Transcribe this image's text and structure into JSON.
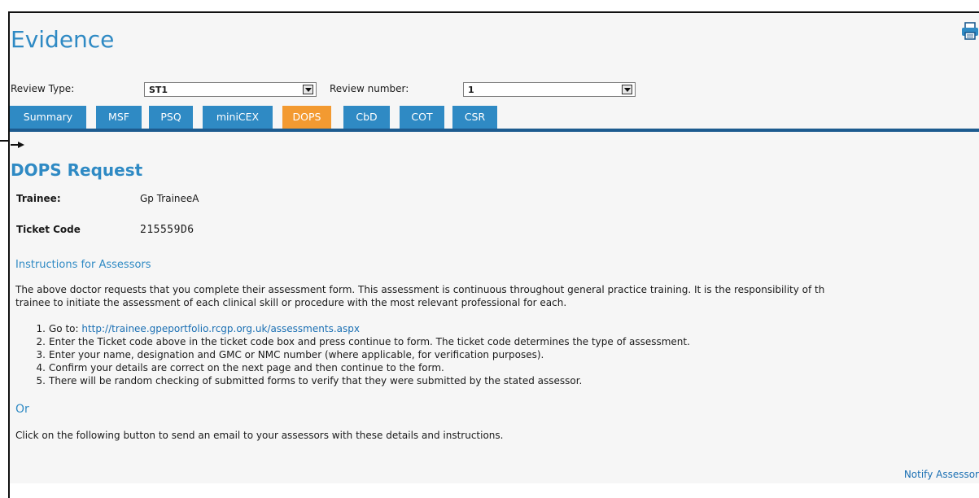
{
  "header": {
    "title": "Evidence"
  },
  "filters": {
    "review_type_label": "Review Type:",
    "review_type_value": "ST1",
    "review_number_label": "Review number:",
    "review_number_value": "1"
  },
  "tabs": [
    {
      "label": "Summary",
      "active": false
    },
    {
      "label": "MSF",
      "active": false
    },
    {
      "label": "PSQ",
      "active": false
    },
    {
      "label": "miniCEX",
      "active": false
    },
    {
      "label": "DOPS",
      "active": true
    },
    {
      "label": "CbD",
      "active": false
    },
    {
      "label": "COT",
      "active": false
    },
    {
      "label": "CSR",
      "active": false
    }
  ],
  "request": {
    "title": "DOPS Request",
    "trainee_label": "Trainee:",
    "trainee_value": "Gp TraineeA",
    "ticket_label": "Ticket Code",
    "ticket_value": "215559D6"
  },
  "instructions": {
    "heading": "Instructions for Assessors",
    "line1": "The above doctor requests that you complete their assessment form. This assessment is continuous throughout general practice training. It is the responsibility of th",
    "line2": "trainee to initiate the assessment of each clinical skill or procedure with the most relevant professional for each.",
    "steps": [
      {
        "num": "1.",
        "text": "Go to: ",
        "link": "http://trainee.gpeportfolio.rcgp.org.uk/assessments.aspx"
      },
      {
        "num": "2.",
        "text": "Enter the Ticket code above in the ticket code box and press continue to form. The ticket code determines the type of assessment."
      },
      {
        "num": "3.",
        "text": "Enter your name, designation and GMC or NMC number (where applicable, for verification purposes)."
      },
      {
        "num": "4.",
        "text": "Confirm your details are correct on the next page and then continue to the form."
      },
      {
        "num": "5.",
        "text": "There will be random checking of submitted forms to verify that they were submitted by the stated assessor."
      }
    ],
    "or": "Or",
    "email_note": "Click on the following button to send an email to your assessors with these details and instructions.",
    "notify_link": "Notify Assessor"
  },
  "colors": {
    "accent": "#2f8ac4",
    "active_tab": "#f39a31",
    "tab_rule": "#1d5b8f",
    "link": "#1a6fb3"
  },
  "icons": {
    "print": "printer-icon",
    "marker": "arrow-right-icon"
  }
}
